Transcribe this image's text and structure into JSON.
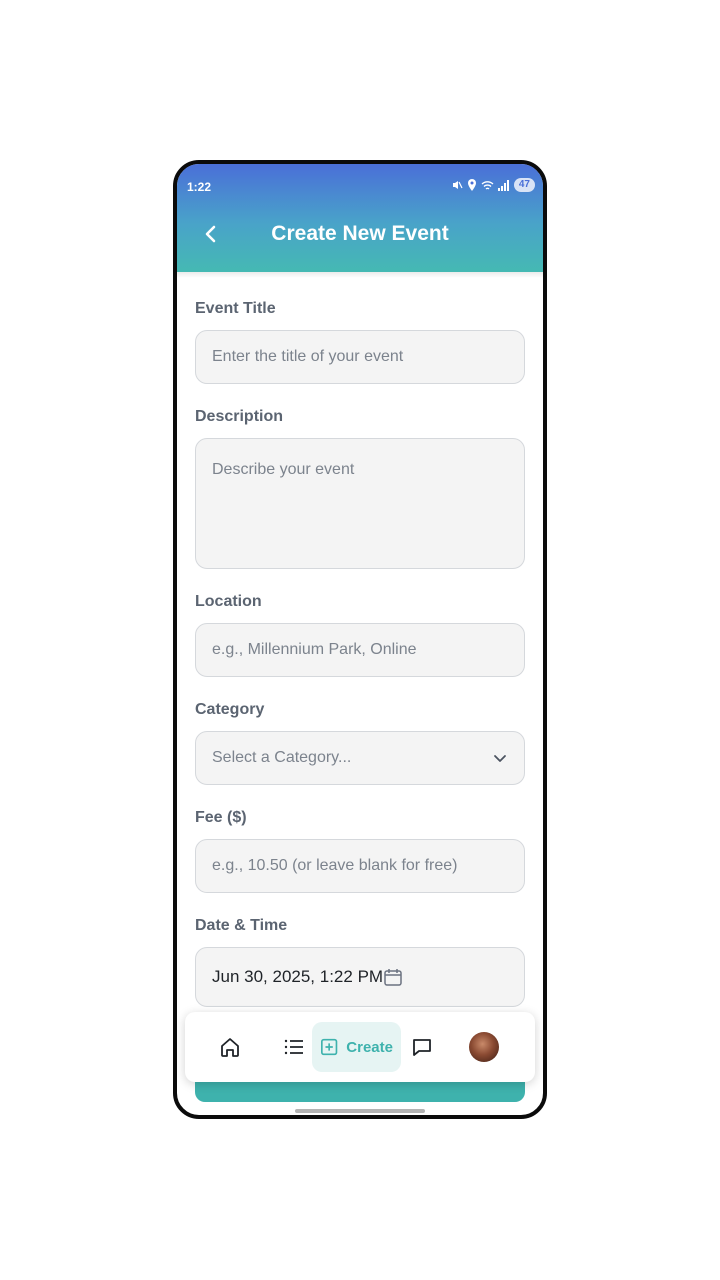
{
  "status_bar": {
    "time": "1:22",
    "battery": "47"
  },
  "header": {
    "title": "Create New Event",
    "back_icon": "chevron-left-icon"
  },
  "form": {
    "event_title": {
      "label": "Event Title",
      "placeholder": "Enter the title of your event"
    },
    "description": {
      "label": "Description",
      "placeholder": "Describe your event"
    },
    "location": {
      "label": "Location",
      "placeholder": "e.g., Millennium Park, Online"
    },
    "category": {
      "label": "Category",
      "selected": "Select a Category..."
    },
    "fee": {
      "label": "Fee ($)",
      "placeholder": "e.g., 10.50 (or leave blank for free)"
    },
    "date_time": {
      "label": "Date & Time",
      "value": "Jun 30, 2025, 1:22 PM"
    }
  },
  "bottom_nav": {
    "items": [
      {
        "icon": "home-icon"
      },
      {
        "icon": "list-icon"
      },
      {
        "icon": "plus-square-icon",
        "label": "Create"
      },
      {
        "icon": "chat-icon"
      },
      {
        "icon": "avatar"
      }
    ]
  },
  "colors": {
    "accent": "#3eb2ad",
    "header_top": "#4a6fd8",
    "header_bottom": "#45b9b3"
  }
}
